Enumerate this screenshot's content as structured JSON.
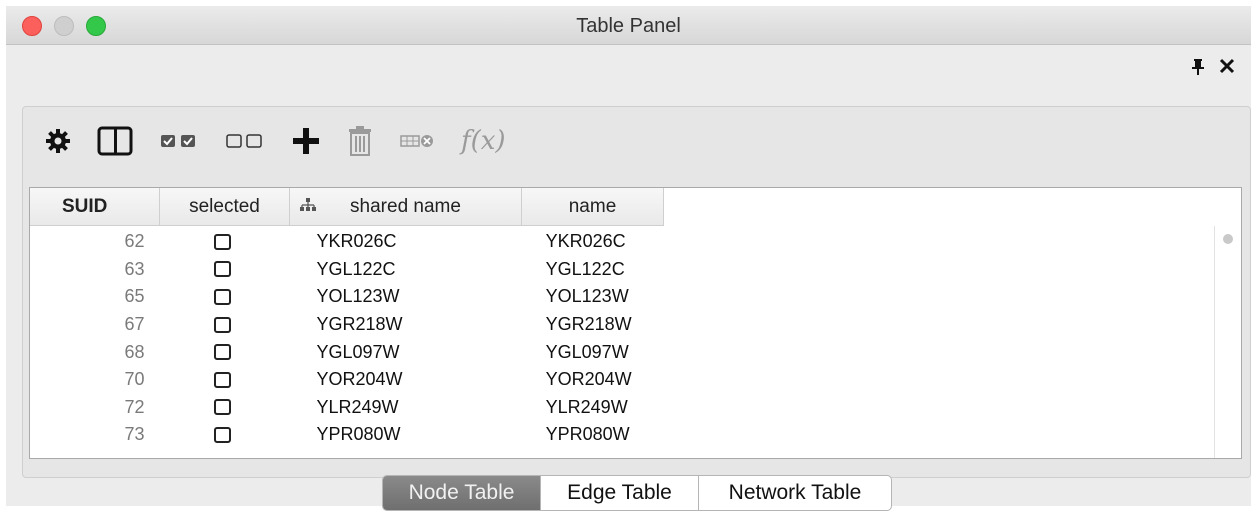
{
  "window": {
    "title": "Table Panel"
  },
  "header_icons": [
    "pin-icon",
    "close-icon"
  ],
  "toolbar": {
    "icons": [
      "gear-icon",
      "column-toggle-icon",
      "select-all-icon",
      "deselect-all-icon",
      "add-icon",
      "trash-icon",
      "delete-column-icon",
      "function-icon"
    ],
    "function_label": "f(x)"
  },
  "table": {
    "columns": {
      "suid": "SUID",
      "selected": "selected",
      "shared_name": "shared name",
      "name": "name"
    },
    "rows": [
      {
        "suid": "62",
        "shared_name": "YKR026C",
        "name": "YKR026C"
      },
      {
        "suid": "63",
        "shared_name": "YGL122C",
        "name": "YGL122C"
      },
      {
        "suid": "65",
        "shared_name": "YOL123W",
        "name": "YOL123W"
      },
      {
        "suid": "67",
        "shared_name": "YGR218W",
        "name": "YGR218W"
      },
      {
        "suid": "68",
        "shared_name": "YGL097W",
        "name": "YGL097W"
      },
      {
        "suid": "70",
        "shared_name": "YOR204W",
        "name": "YOR204W"
      },
      {
        "suid": "72",
        "shared_name": "YLR249W",
        "name": "YLR249W"
      },
      {
        "suid": "73",
        "shared_name": "YPR080W",
        "name": "YPR080W"
      }
    ]
  },
  "tabs": [
    {
      "label": "Node Table",
      "active": true
    },
    {
      "label": "Edge Table",
      "active": false
    },
    {
      "label": "Network Table",
      "active": false
    }
  ],
  "colors": {
    "active_tab": "#7d7d7d",
    "close": "#fc605c",
    "minimize": "#cfcfcf",
    "zoom": "#34c84a"
  }
}
